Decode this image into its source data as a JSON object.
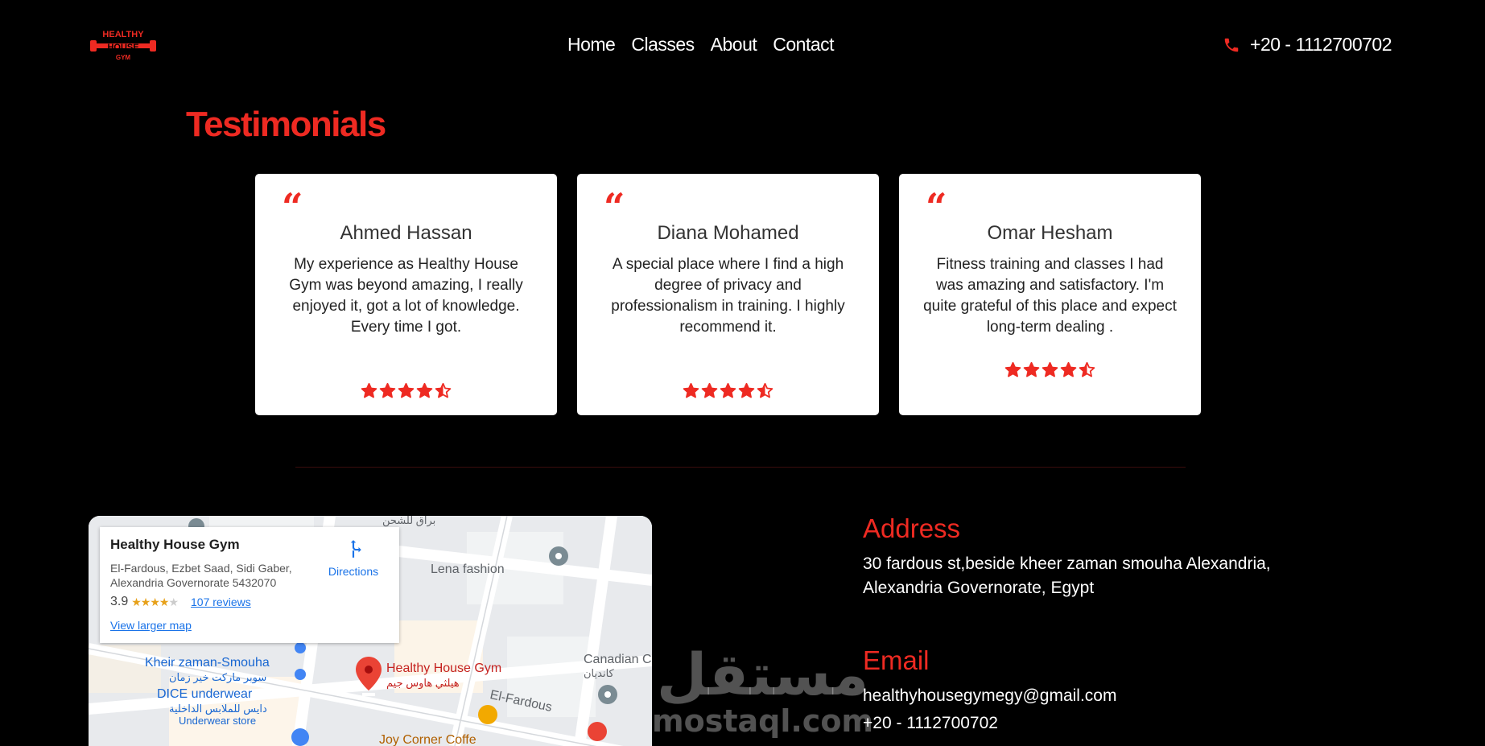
{
  "brand": {
    "logo_text_1": "HEALTHY",
    "logo_text_2": "HOUSE",
    "logo_text_3": "GYM",
    "accent": "#ee2a22"
  },
  "nav": {
    "items": [
      {
        "label": "Home"
      },
      {
        "label": "Classes"
      },
      {
        "label": "About"
      },
      {
        "label": "Contact"
      }
    ],
    "phone": "+20 - 1112700702",
    "phone_icon": "phone-icon"
  },
  "testimonials": {
    "title": "Testimonials",
    "cards": [
      {
        "name": "Ahmed Hassan",
        "text": "My experience as Healthy House Gym was beyond amazing, I really enjoyed it, got a lot of knowledge. Every time I got.",
        "rating": 4.5
      },
      {
        "name": "Diana Mohamed",
        "text": "A special place where I find a high degree of privacy and professionalism in training. I highly recommend it.",
        "rating": 4.5
      },
      {
        "name": "Omar Hesham",
        "text": "Fitness training and classes I had was amazing and satisfactory. I'm quite grateful of this place and expect long-term dealing .",
        "rating": 4.5
      }
    ]
  },
  "map": {
    "place_name": "Healthy House Gym",
    "place_address": "El-Fardous, Ezbet Saad, Sidi Gaber, Alexandria Governorate 5432070",
    "rating": "3.9",
    "reviews": "107 reviews",
    "directions": "Directions",
    "view_larger": "View larger map",
    "labels": {
      "lena": "Lena fashion",
      "kheir": "Kheir zaman-Smouha",
      "kheir_ar": "سوبر ماركت خير زمان",
      "dice": "DICE underwear",
      "dice_ar": "دايس للملابس الداخلية",
      "dice_sub": "Underwear store",
      "gym": "Healthy House Gym",
      "gym_ar": "هيلثي هاوس جيم",
      "fardous": "El-Fardous",
      "canadian": "Canadian C",
      "canadian_ar": "كانديان",
      "joy": "Joy Corner Coffe",
      "top_ar": "براق للشحن"
    }
  },
  "watermark": {
    "arabic": "مستقل",
    "latin": "mostaql.com"
  },
  "contact": {
    "address_title": "Address",
    "address_line1": "30 fardous st,beside kheer zaman smouha Alexandria,",
    "address_line2": "Alexandria Governorate, Egypt",
    "email_title": "Email",
    "email": "healthyhousegymegy@gmail.com",
    "phone": "+20 - 1112700702"
  }
}
